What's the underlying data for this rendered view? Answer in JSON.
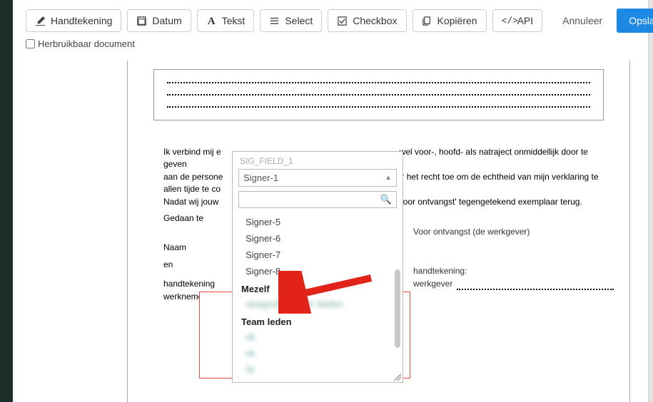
{
  "toolbar": {
    "signature_label": "Handtekening",
    "date_label": "Datum",
    "text_label": "Tekst",
    "select_label": "Select",
    "checkbox_label": "Checkbox",
    "copy_label": "Kopiëren",
    "api_label": "API",
    "cancel_label": "Annuleer",
    "save_label": "Opslaan"
  },
  "reuse": {
    "label": "Herbruikbaar document",
    "checked": false
  },
  "doc": {
    "para_line1": "Ik verbind mij e",
    "para_line1b": "wel voor-, hoofd- als natraject onmiddellijk door te geven",
    "para_line2": "aan de persone",
    "para_line2b": "r het recht toe om de echtheid van mijn verklaring te",
    "para_line3": "allen tijde te co",
    "para_line4": "Nadat wij jouw",
    "para_line4b": "'voor ontvangst' tegengetekend exemplaar terug.",
    "gedaan": "Gedaan te",
    "naam": "Naam",
    "en": "en",
    "handtek_werknemer_l1": "handtekening",
    "handtek_werknemer_l2": "werknemer",
    "voor_ontvangst": "Voor ontvangst (de werkgever)",
    "handtek_werkgever_l1": "handtekening:",
    "handtek_werkgever_l2": "werkgever"
  },
  "dropdown": {
    "field_label": "SIG_FIELD_1",
    "selected": "Signer-1",
    "search_value": "",
    "options": {
      "signers": [
        "Signer-5",
        "Signer-6",
        "Signer-7",
        "Signer-8"
      ],
      "mezelf_group": "Mezelf",
      "mezelf_items": [
        "oksign20220010 Stefan"
      ],
      "team_group": "Team leden",
      "team_items": [
        "ok",
        "ok",
        "St"
      ]
    }
  }
}
